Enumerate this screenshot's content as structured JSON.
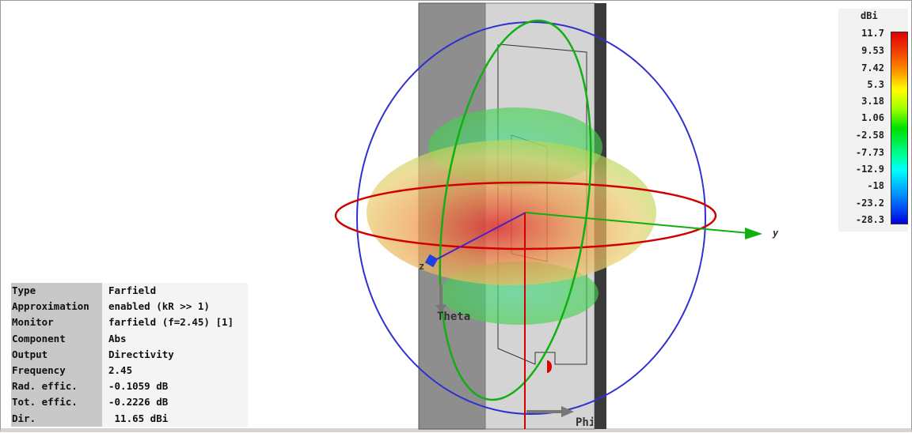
{
  "legend": {
    "unit": "dBi",
    "ticks": [
      "11.7",
      "9.53",
      "7.42",
      "5.3",
      "3.18",
      "1.06",
      "-2.58",
      "-7.73",
      "-12.9",
      "-18",
      "-23.2",
      "-28.3"
    ],
    "range": [
      -28.3,
      11.7
    ]
  },
  "axes": {
    "y": "y",
    "z": "z",
    "theta": "Theta",
    "phi": "Phi"
  },
  "info": [
    {
      "key": "Type",
      "value": "Farfield"
    },
    {
      "key": "Approximation",
      "value": "enabled (kR >> 1)"
    },
    {
      "key": "Monitor",
      "value": "farfield (f=2.45) [1]"
    },
    {
      "key": "Component",
      "value": "Abs"
    },
    {
      "key": "Output",
      "value": "Directivity"
    },
    {
      "key": "Frequency",
      "value": "2.45"
    },
    {
      "key": "Rad. effic.",
      "value": "-0.1059 dB"
    },
    {
      "key": "Tot. effic.",
      "value": "-0.2226 dB"
    },
    {
      "key": "Dir.",
      "value": " 11.65 dBi"
    }
  ],
  "colors": {
    "phi_circle": "#d00000",
    "theta_circle": "#10b010",
    "sphere": "#3030d0"
  }
}
